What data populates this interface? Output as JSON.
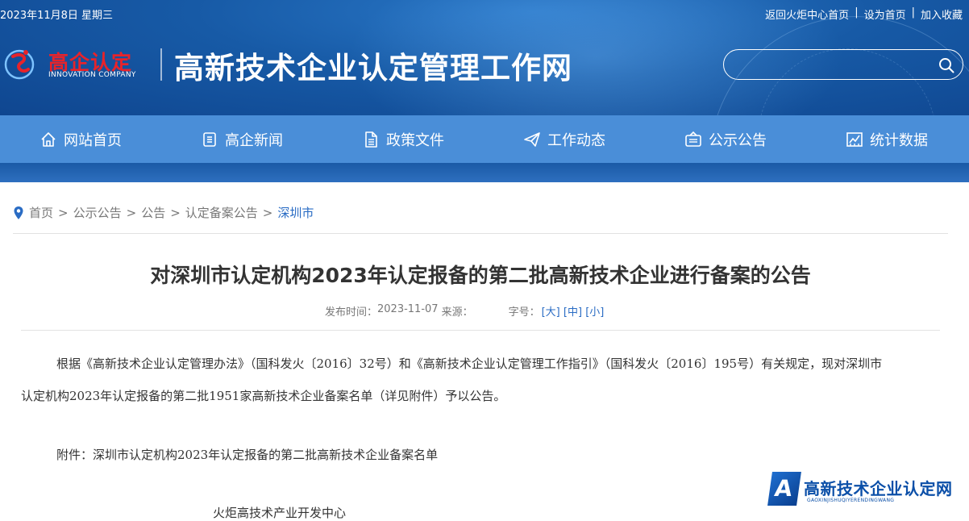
{
  "header": {
    "date": "2023年11月8日 星期三",
    "links": [
      "返回火炬中心首页",
      "设为首页",
      "加入收藏"
    ],
    "logo_cn": "高企认定",
    "logo_en": "INNOVATION COMPANY",
    "site_name": "高新技术企业认定管理工作网",
    "search_placeholder": ""
  },
  "nav": [
    {
      "label": "网站首页",
      "icon": "home-icon"
    },
    {
      "label": "高企新闻",
      "icon": "news-icon"
    },
    {
      "label": "政策文件",
      "icon": "document-icon"
    },
    {
      "label": "工作动态",
      "icon": "paper-plane-icon"
    },
    {
      "label": "公示公告",
      "icon": "notice-icon"
    },
    {
      "label": "统计数据",
      "icon": "chart-icon"
    }
  ],
  "breadcrumb": [
    "首页",
    "公示公告",
    "公告",
    "认定备案公告",
    "深圳市"
  ],
  "article": {
    "title": "对深圳市认定机构2023年认定报备的第二批高新技术企业进行备案的公告",
    "published_label": "发布时间：",
    "published_date": "2023-11-07",
    "source_label": "来源：",
    "font_label": "字号：",
    "font_sizes": [
      "[大]",
      "[中]",
      "[小]"
    ],
    "para1_line1": "根据《高新技术企业认定管理办法》（国科发火〔2016〕32号）和《高新技术企业认定管理工作指引》（国科发火〔2016〕195号）有关规定，现对深圳市",
    "para1_line2": "认定机构2023年认定报备的第二批1951家高新技术企业备案名单（详见附件）予以公告。",
    "attachment": "附件：深圳市认定机构2023年认定报备的第二批高新技术企业备案名单",
    "footer_partial": "火炬高技术产业开发中心"
  },
  "watermark": {
    "cn": "高新技术企业认定网",
    "en": "GAOXINJISHUQIYERENDINGWANG",
    "letter": "A"
  },
  "colors": {
    "banner": "#175aa6",
    "nav": "#4a8ed8",
    "accent": "#2a6cc4",
    "logo_red": "#e8232a"
  }
}
